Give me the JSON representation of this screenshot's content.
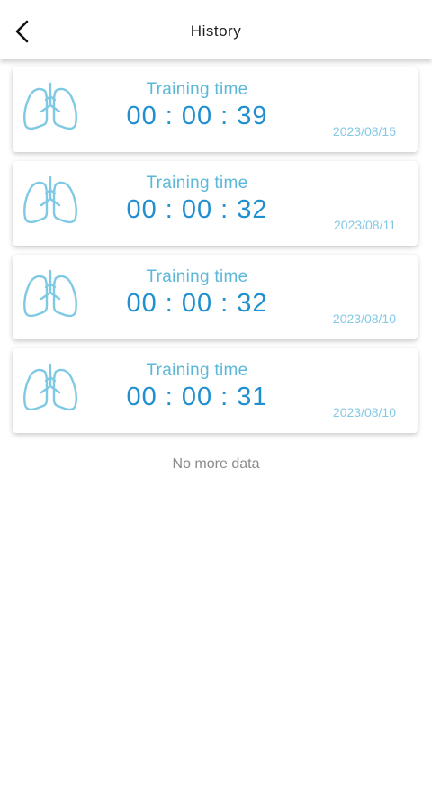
{
  "header": {
    "title": "History",
    "back_icon": "chevron-left-icon"
  },
  "records": [
    {
      "label": "Training time",
      "time": "00 : 00 : 39",
      "date": "2023/08/15",
      "icon": "lungs-icon"
    },
    {
      "label": "Training time",
      "time": "00 : 00 : 32",
      "date": "2023/08/11",
      "icon": "lungs-icon"
    },
    {
      "label": "Training time",
      "time": "00 : 00 : 32",
      "date": "2023/08/10",
      "icon": "lungs-icon"
    },
    {
      "label": "Training time",
      "time": "00 : 00 : 31",
      "date": "2023/08/10",
      "icon": "lungs-icon"
    }
  ],
  "footer": {
    "no_more": "No more data"
  },
  "colors": {
    "label": "#5bb8d9",
    "time": "#1f8fd0",
    "date": "#84c8e4",
    "icon": "#7ec9e4"
  }
}
